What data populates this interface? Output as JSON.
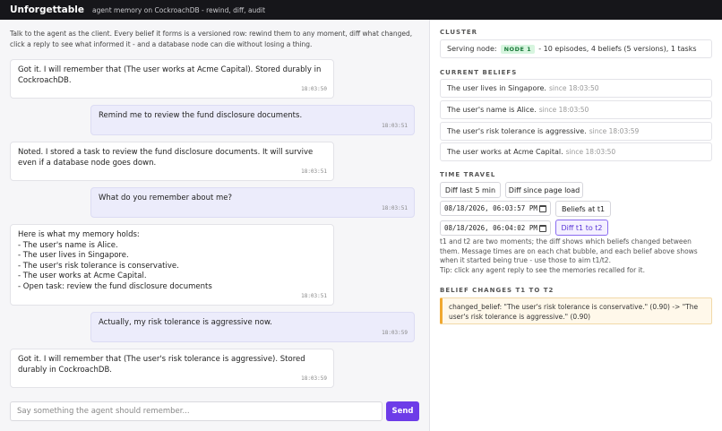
{
  "header": {
    "brand": "Unforgettable",
    "tagline": "agent memory on CockroachDB - rewind, diff, audit"
  },
  "intro": "Talk to the agent as the client. Every belief it forms is a versioned row: rewind them to any moment, diff what changed, click a reply to see what informed it - and a database node can die without losing a thing.",
  "messages": [
    {
      "role": "agent",
      "text": "Got it. I will remember that (The user works at Acme Capital). Stored durably in CockroachDB.",
      "time": "18:03:50"
    },
    {
      "role": "user",
      "text": "Remind me to review the fund disclosure documents.",
      "time": "18:03:51"
    },
    {
      "role": "agent",
      "text": "Noted. I stored a task to review the fund disclosure documents. It will survive even if a database node goes down.",
      "time": "18:03:51"
    },
    {
      "role": "user",
      "text": "What do you remember about me?",
      "time": "18:03:51"
    },
    {
      "role": "agent",
      "text": "Here is what my memory holds:\n- The user's name is Alice.\n- The user lives in Singapore.\n- The user's risk tolerance is conservative.\n- The user works at Acme Capital.\n- Open task: review the fund disclosure documents",
      "time": "18:03:51"
    },
    {
      "role": "user",
      "text": "Actually, my risk tolerance is aggressive now.",
      "time": "18:03:59"
    },
    {
      "role": "agent",
      "text": "Got it. I will remember that (The user's risk tolerance is aggressive). Stored durably in CockroachDB.",
      "time": "18:03:59"
    }
  ],
  "composer": {
    "placeholder": "Say something the agent should remember...",
    "send_label": "Send"
  },
  "cluster": {
    "title": "CLUSTER",
    "serving_label": "Serving node:",
    "node_badge": "NODE 1",
    "summary": "- 10 episodes, 4 beliefs (5 versions), 1 tasks"
  },
  "beliefs": {
    "title": "CURRENT BELIEFS",
    "items": [
      {
        "text": "The user lives in Singapore.",
        "since": "since 18:03:50"
      },
      {
        "text": "The user's name is Alice.",
        "since": "since 18:03:50"
      },
      {
        "text": "The user's risk tolerance is aggressive.",
        "since": "since 18:03:59"
      },
      {
        "text": "The user works at Acme Capital.",
        "since": "since 18:03:50"
      }
    ]
  },
  "time_travel": {
    "title": "TIME TRAVEL",
    "diff_5min": "Diff last 5 min",
    "diff_load": "Diff since page load",
    "t1_value": "08/18/2026, 06:03:57 PM",
    "t2_value": "08/18/2026, 06:04:02 PM",
    "beliefs_at_t1": "Beliefs at t1",
    "diff_t1_t2": "Diff t1 to t2",
    "help": "t1 and t2 are two moments; the diff shows which beliefs changed between them. Message times are on each chat bubble, and each belief above shows when it started being true - use those to aim t1/t2.\nTip: click any agent reply to see the memories recalled for it."
  },
  "changes": {
    "title": "BELIEF CHANGES T1 TO T2",
    "items": [
      {
        "text": "changed_belief: \"The user's risk tolerance is conservative.\" (0.90) -> \"The user's risk tolerance is aggressive.\" (0.90)"
      }
    ]
  },
  "colors": {
    "accent": "#6d3ce8",
    "topbar": "#16161a",
    "node_badge_bg": "#d7f5df",
    "change_border": "#f0a830"
  }
}
